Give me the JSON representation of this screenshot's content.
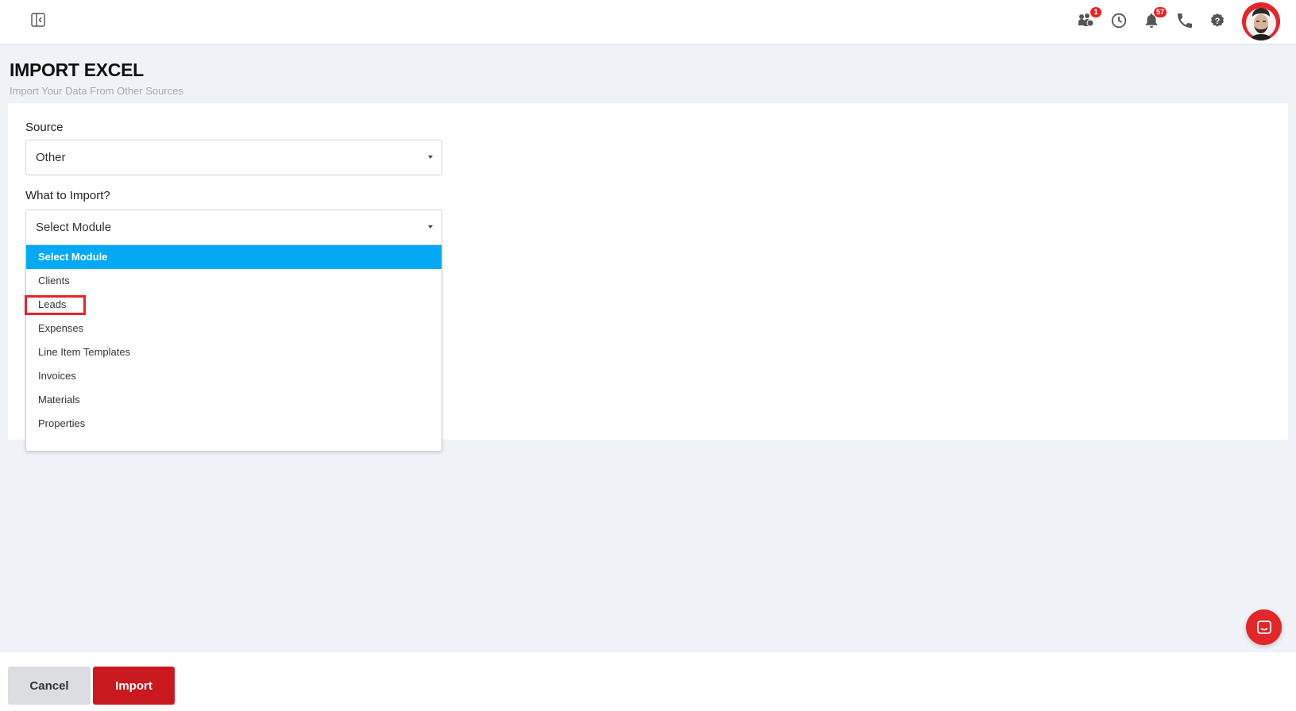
{
  "header": {
    "badges": {
      "team": "1",
      "notifications": "57"
    },
    "icons": [
      "sidebar-toggle-icon",
      "team-icon",
      "clock-icon",
      "bell-icon",
      "phone-icon",
      "help-icon"
    ]
  },
  "page": {
    "title": "IMPORT EXCEL",
    "subtitle": "Import Your Data From Other Sources"
  },
  "form": {
    "source_label": "Source",
    "source_value": "Other",
    "module_label": "What to Import?",
    "module_value": "Select Module",
    "module_options": [
      "Select Module",
      "Clients",
      "Leads",
      "Expenses",
      "Line Item Templates",
      "Invoices",
      "Materials",
      "Properties"
    ],
    "selected_option_index": 0,
    "highlighted_option": "Leads"
  },
  "footer": {
    "cancel_label": "Cancel",
    "import_label": "Import"
  },
  "colors": {
    "brand_red": "#e32628",
    "import_button": "#c9191e",
    "option_selected_bg": "#03a9f4",
    "page_bg": "#eff2f7"
  }
}
